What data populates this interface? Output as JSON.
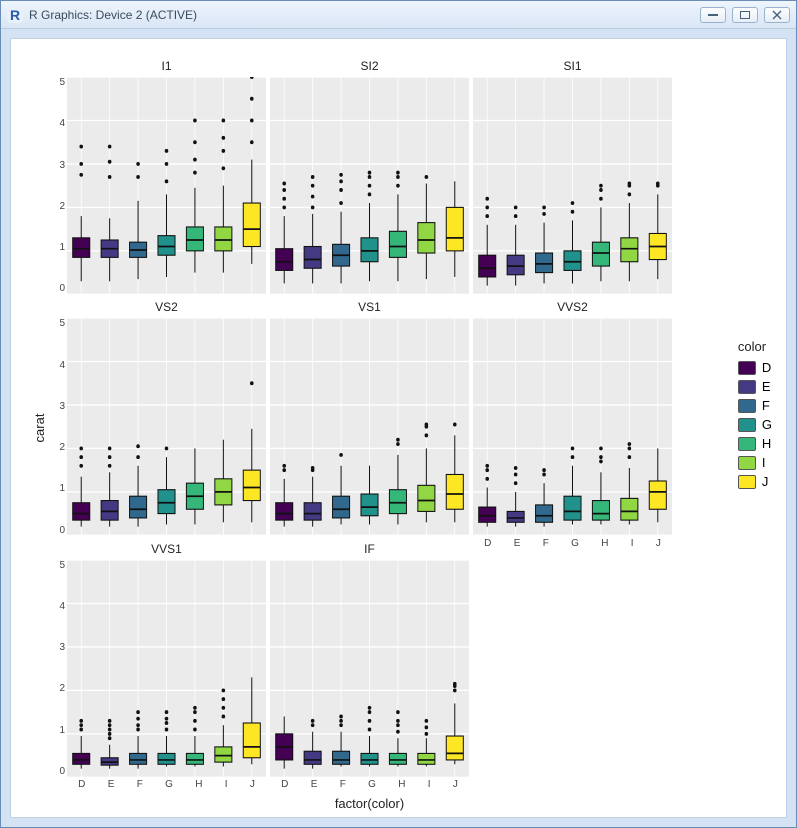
{
  "window": {
    "title": "R Graphics: Device 2 (ACTIVE)"
  },
  "chart_data": {
    "type": "boxplot",
    "xlabel": "factor(color)",
    "ylabel": "carat",
    "ylim": [
      0,
      5
    ],
    "yticks": [
      0,
      1,
      2,
      3,
      4,
      5
    ],
    "categories": [
      "D",
      "E",
      "F",
      "G",
      "H",
      "I",
      "J"
    ],
    "colors": {
      "D": "#440154",
      "E": "#443a83",
      "F": "#31688e",
      "G": "#21918c",
      "H": "#35b779",
      "I": "#90d743",
      "J": "#fde725"
    },
    "legend_title": "color",
    "legend": [
      "D",
      "E",
      "F",
      "G",
      "H",
      "I",
      "J"
    ],
    "facets": [
      {
        "name": "I1",
        "boxes": [
          {
            "cat": "D",
            "min": 0.3,
            "q1": 0.85,
            "med": 1.05,
            "q3": 1.3,
            "max": 1.8,
            "out": [
              2.75,
              3.0,
              3.4
            ]
          },
          {
            "cat": "E",
            "min": 0.3,
            "q1": 0.85,
            "med": 1.05,
            "q3": 1.25,
            "max": 1.75,
            "out": [
              2.7,
              3.05,
              3.4
            ]
          },
          {
            "cat": "F",
            "min": 0.35,
            "q1": 0.85,
            "med": 1.02,
            "q3": 1.2,
            "max": 2.15,
            "out": [
              2.7,
              3.0
            ]
          },
          {
            "cat": "G",
            "min": 0.4,
            "q1": 0.9,
            "med": 1.1,
            "q3": 1.35,
            "max": 2.3,
            "out": [
              2.6,
              3.0,
              3.3
            ]
          },
          {
            "cat": "H",
            "min": 0.5,
            "q1": 1.0,
            "med": 1.25,
            "q3": 1.55,
            "max": 2.45,
            "out": [
              2.8,
              3.1,
              3.5,
              4.0
            ]
          },
          {
            "cat": "I",
            "min": 0.5,
            "q1": 1.0,
            "med": 1.25,
            "q3": 1.55,
            "max": 2.5,
            "out": [
              2.9,
              3.3,
              3.6,
              4.0
            ]
          },
          {
            "cat": "J",
            "min": 0.7,
            "q1": 1.1,
            "med": 1.5,
            "q3": 2.1,
            "max": 3.1,
            "out": [
              3.5,
              4.0,
              4.5,
              5.0
            ]
          }
        ]
      },
      {
        "name": "SI2",
        "boxes": [
          {
            "cat": "D",
            "min": 0.25,
            "q1": 0.55,
            "med": 0.75,
            "q3": 1.05,
            "max": 1.8,
            "out": [
              2.0,
              2.2,
              2.4,
              2.55
            ]
          },
          {
            "cat": "E",
            "min": 0.25,
            "q1": 0.6,
            "med": 0.8,
            "q3": 1.1,
            "max": 1.85,
            "out": [
              2.0,
              2.25,
              2.5,
              2.7
            ]
          },
          {
            "cat": "F",
            "min": 0.25,
            "q1": 0.65,
            "med": 0.9,
            "q3": 1.15,
            "max": 1.9,
            "out": [
              2.1,
              2.4,
              2.6,
              2.75
            ]
          },
          {
            "cat": "G",
            "min": 0.3,
            "q1": 0.75,
            "med": 1.0,
            "q3": 1.3,
            "max": 2.1,
            "out": [
              2.3,
              2.5,
              2.7,
              2.8
            ]
          },
          {
            "cat": "H",
            "min": 0.3,
            "q1": 0.85,
            "med": 1.1,
            "q3": 1.45,
            "max": 2.3,
            "out": [
              2.5,
              2.7,
              2.8
            ]
          },
          {
            "cat": "I",
            "min": 0.35,
            "q1": 0.95,
            "med": 1.25,
            "q3": 1.65,
            "max": 2.55,
            "out": [
              2.7
            ]
          },
          {
            "cat": "J",
            "min": 0.4,
            "q1": 1.0,
            "med": 1.3,
            "q3": 2.0,
            "max": 2.6,
            "out": []
          }
        ]
      },
      {
        "name": "SI1",
        "boxes": [
          {
            "cat": "D",
            "min": 0.2,
            "q1": 0.4,
            "med": 0.6,
            "q3": 0.9,
            "max": 1.6,
            "out": [
              1.8,
              2.0,
              2.2
            ]
          },
          {
            "cat": "E",
            "min": 0.2,
            "q1": 0.45,
            "med": 0.65,
            "q3": 0.9,
            "max": 1.6,
            "out": [
              1.8,
              2.0
            ]
          },
          {
            "cat": "F",
            "min": 0.25,
            "q1": 0.5,
            "med": 0.7,
            "q3": 0.95,
            "max": 1.65,
            "out": [
              1.85,
              2.0
            ]
          },
          {
            "cat": "G",
            "min": 0.25,
            "q1": 0.55,
            "med": 0.75,
            "q3": 1.0,
            "max": 1.7,
            "out": [
              1.9,
              2.1
            ]
          },
          {
            "cat": "H",
            "min": 0.3,
            "q1": 0.65,
            "med": 0.95,
            "q3": 1.2,
            "max": 2.0,
            "out": [
              2.2,
              2.4,
              2.5
            ]
          },
          {
            "cat": "I",
            "min": 0.3,
            "q1": 0.75,
            "med": 1.05,
            "q3": 1.3,
            "max": 2.1,
            "out": [
              2.3,
              2.5,
              2.55
            ]
          },
          {
            "cat": "J",
            "min": 0.35,
            "q1": 0.8,
            "med": 1.1,
            "q3": 1.4,
            "max": 2.3,
            "out": [
              2.5,
              2.55
            ]
          }
        ]
      },
      {
        "name": "VS2",
        "boxes": [
          {
            "cat": "D",
            "min": 0.2,
            "q1": 0.35,
            "med": 0.5,
            "q3": 0.75,
            "max": 1.35,
            "out": [
              1.6,
              1.8,
              2.0
            ]
          },
          {
            "cat": "E",
            "min": 0.2,
            "q1": 0.35,
            "med": 0.55,
            "q3": 0.8,
            "max": 1.45,
            "out": [
              1.6,
              1.8,
              2.0
            ]
          },
          {
            "cat": "F",
            "min": 0.2,
            "q1": 0.4,
            "med": 0.6,
            "q3": 0.9,
            "max": 1.6,
            "out": [
              1.8,
              2.05
            ]
          },
          {
            "cat": "G",
            "min": 0.25,
            "q1": 0.5,
            "med": 0.75,
            "q3": 1.05,
            "max": 1.8,
            "out": [
              2.0
            ]
          },
          {
            "cat": "H",
            "min": 0.25,
            "q1": 0.6,
            "med": 0.9,
            "q3": 1.2,
            "max": 2.0,
            "out": []
          },
          {
            "cat": "I",
            "min": 0.3,
            "q1": 0.7,
            "med": 1.0,
            "q3": 1.3,
            "max": 2.2,
            "out": []
          },
          {
            "cat": "J",
            "min": 0.3,
            "q1": 0.8,
            "med": 1.1,
            "q3": 1.5,
            "max": 2.45,
            "out": [
              3.5
            ]
          }
        ]
      },
      {
        "name": "VS1",
        "boxes": [
          {
            "cat": "D",
            "min": 0.2,
            "q1": 0.35,
            "med": 0.5,
            "q3": 0.75,
            "max": 1.3,
            "out": [
              1.5,
              1.6
            ]
          },
          {
            "cat": "E",
            "min": 0.2,
            "q1": 0.35,
            "med": 0.5,
            "q3": 0.75,
            "max": 1.35,
            "out": [
              1.5,
              1.55
            ]
          },
          {
            "cat": "F",
            "min": 0.25,
            "q1": 0.4,
            "med": 0.6,
            "q3": 0.9,
            "max": 1.6,
            "out": [
              1.85
            ]
          },
          {
            "cat": "G",
            "min": 0.25,
            "q1": 0.45,
            "med": 0.65,
            "q3": 0.95,
            "max": 1.6,
            "out": []
          },
          {
            "cat": "H",
            "min": 0.25,
            "q1": 0.5,
            "med": 0.75,
            "q3": 1.05,
            "max": 1.85,
            "out": [
              2.1,
              2.2
            ]
          },
          {
            "cat": "I",
            "min": 0.3,
            "q1": 0.55,
            "med": 0.8,
            "q3": 1.15,
            "max": 2.0,
            "out": [
              2.3,
              2.5,
              2.55
            ]
          },
          {
            "cat": "J",
            "min": 0.3,
            "q1": 0.6,
            "med": 0.95,
            "q3": 1.4,
            "max": 2.3,
            "out": [
              2.55
            ]
          }
        ]
      },
      {
        "name": "VVS2",
        "boxes": [
          {
            "cat": "D",
            "min": 0.2,
            "q1": 0.3,
            "med": 0.45,
            "q3": 0.65,
            "max": 1.1,
            "out": [
              1.3,
              1.5,
              1.6
            ]
          },
          {
            "cat": "E",
            "min": 0.2,
            "q1": 0.3,
            "med": 0.4,
            "q3": 0.55,
            "max": 1.0,
            "out": [
              1.2,
              1.4,
              1.55
            ]
          },
          {
            "cat": "F",
            "min": 0.2,
            "q1": 0.3,
            "med": 0.45,
            "q3": 0.7,
            "max": 1.2,
            "out": [
              1.4,
              1.5
            ]
          },
          {
            "cat": "G",
            "min": 0.25,
            "q1": 0.35,
            "med": 0.55,
            "q3": 0.9,
            "max": 1.6,
            "out": [
              1.8,
              2.0
            ]
          },
          {
            "cat": "H",
            "min": 0.25,
            "q1": 0.35,
            "med": 0.5,
            "q3": 0.8,
            "max": 1.45,
            "out": [
              1.7,
              1.8,
              2.0
            ]
          },
          {
            "cat": "I",
            "min": 0.25,
            "q1": 0.35,
            "med": 0.55,
            "q3": 0.85,
            "max": 1.55,
            "out": [
              1.8,
              2.0,
              2.1
            ]
          },
          {
            "cat": "J",
            "min": 0.3,
            "q1": 0.6,
            "med": 1.0,
            "q3": 1.25,
            "max": 2.0,
            "out": []
          }
        ]
      },
      {
        "name": "VVS1",
        "boxes": [
          {
            "cat": "D",
            "min": 0.2,
            "q1": 0.3,
            "med": 0.4,
            "q3": 0.55,
            "max": 0.95,
            "out": [
              1.1,
              1.2,
              1.3
            ]
          },
          {
            "cat": "E",
            "min": 0.2,
            "q1": 0.28,
            "med": 0.35,
            "q3": 0.45,
            "max": 0.75,
            "out": [
              0.9,
              1.0,
              1.1,
              1.2,
              1.3
            ]
          },
          {
            "cat": "F",
            "min": 0.2,
            "q1": 0.3,
            "med": 0.4,
            "q3": 0.55,
            "max": 0.95,
            "out": [
              1.1,
              1.2,
              1.35,
              1.5
            ]
          },
          {
            "cat": "G",
            "min": 0.25,
            "q1": 0.3,
            "med": 0.4,
            "q3": 0.55,
            "max": 0.95,
            "out": [
              1.1,
              1.25,
              1.35,
              1.5
            ]
          },
          {
            "cat": "H",
            "min": 0.25,
            "q1": 0.3,
            "med": 0.4,
            "q3": 0.55,
            "max": 0.95,
            "out": [
              1.1,
              1.3,
              1.5,
              1.6
            ]
          },
          {
            "cat": "I",
            "min": 0.25,
            "q1": 0.35,
            "med": 0.5,
            "q3": 0.7,
            "max": 1.2,
            "out": [
              1.4,
              1.6,
              1.8,
              2.0
            ]
          },
          {
            "cat": "J",
            "min": 0.3,
            "q1": 0.45,
            "med": 0.7,
            "q3": 1.25,
            "max": 2.3,
            "out": []
          }
        ]
      },
      {
        "name": "IF",
        "boxes": [
          {
            "cat": "D",
            "min": 0.2,
            "q1": 0.4,
            "med": 0.7,
            "q3": 1.0,
            "max": 1.4,
            "out": []
          },
          {
            "cat": "E",
            "min": 0.2,
            "q1": 0.3,
            "med": 0.4,
            "q3": 0.6,
            "max": 1.05,
            "out": [
              1.2,
              1.3
            ]
          },
          {
            "cat": "F",
            "min": 0.25,
            "q1": 0.3,
            "med": 0.4,
            "q3": 0.6,
            "max": 1.05,
            "out": [
              1.2,
              1.3,
              1.4
            ]
          },
          {
            "cat": "G",
            "min": 0.25,
            "q1": 0.3,
            "med": 0.4,
            "q3": 0.55,
            "max": 0.95,
            "out": [
              1.1,
              1.3,
              1.5,
              1.6
            ]
          },
          {
            "cat": "H",
            "min": 0.25,
            "q1": 0.3,
            "med": 0.4,
            "q3": 0.55,
            "max": 0.9,
            "out": [
              1.05,
              1.2,
              1.3,
              1.5
            ]
          },
          {
            "cat": "I",
            "min": 0.25,
            "q1": 0.3,
            "med": 0.4,
            "q3": 0.55,
            "max": 0.9,
            "out": [
              1.0,
              1.15,
              1.3
            ]
          },
          {
            "cat": "J",
            "min": 0.3,
            "q1": 0.4,
            "med": 0.55,
            "q3": 0.95,
            "max": 1.7,
            "out": [
              2.0,
              2.1,
              2.15
            ]
          }
        ]
      }
    ]
  }
}
